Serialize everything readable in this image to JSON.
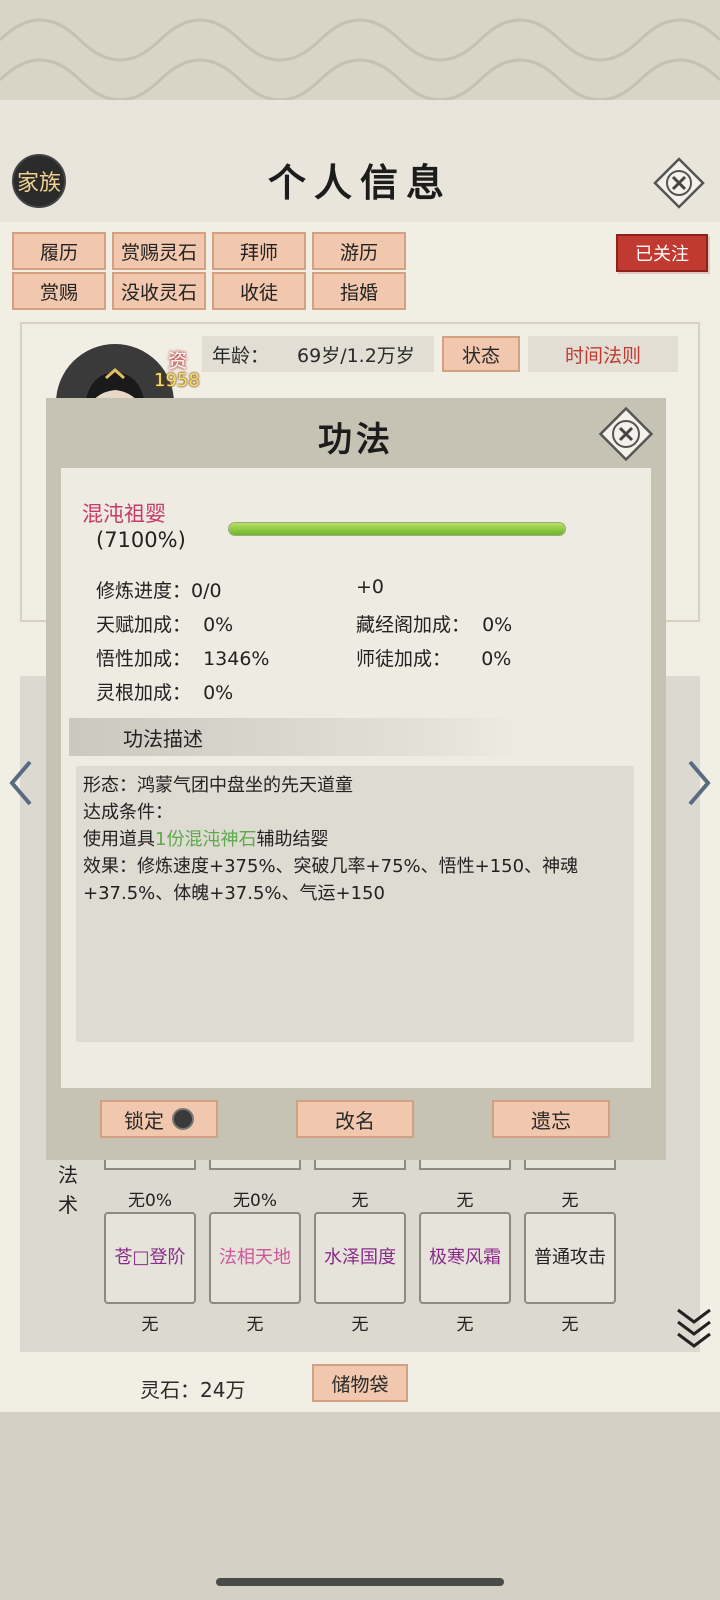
{
  "header": {
    "family_button": "家族",
    "title": "个人信息"
  },
  "tabs_row1": [
    "履历",
    "赏赐灵石",
    "拜师",
    "游历"
  ],
  "tabs_row2": [
    "赏赐",
    "没收灵石",
    "收徒",
    "指婚"
  ],
  "followed": "已关注",
  "profile": {
    "talent_label": "资",
    "talent_value": "1958",
    "age_label": "年龄：",
    "age_value": "69岁/1.2万岁",
    "state_button": "状态",
    "time_law_button": "时间法则"
  },
  "modal": {
    "title": "功法",
    "tech_name": "混沌祖婴",
    "tech_percent": "(7100%)",
    "progress_fraction": 1.0,
    "stats": {
      "cultivation_progress": "修炼进度：0/0",
      "cultivation_bonus": "+0",
      "talent_bonus": "天赋加成：  0%",
      "library_bonus": "藏经阁加成：  0%",
      "comprehension_bonus": "悟性加成：  1346%",
      "master_bonus": "师徒加成：     0%",
      "root_bonus": "灵根加成：  0%"
    },
    "desc_heading": "功法描述",
    "desc_form": "形态：鸿蒙气团中盘坐的先天道童",
    "desc_condition_label": "达成条件：",
    "desc_use_prefix": "使用道具",
    "desc_use_item": "1份混沌神石",
    "desc_use_suffix": "辅助结婴",
    "desc_effect": "效果：修炼速度+375%、突破几率+75%、悟性+150、神魂+37.5%、体魄+37.5%、气运+150",
    "btn_lock": "锁定",
    "btn_rename": "改名",
    "btn_forget": "遗忘"
  },
  "skills_section": {
    "label": "法术",
    "row0_captions": [
      "无0%",
      "无0%",
      "无",
      "无",
      "无"
    ],
    "row1": [
      {
        "name": "苍□登阶",
        "caption": "无",
        "color": "#8a2b8a"
      },
      {
        "name": "法相天地",
        "caption": "无",
        "color": "#d0559a"
      },
      {
        "name": "水泽国度",
        "caption": "无",
        "color": "#8a2b8a"
      },
      {
        "name": "极寒风霜",
        "caption": "无",
        "color": "#8a2b8a"
      },
      {
        "name": "普通攻击",
        "caption": "无",
        "color": "#222222"
      }
    ]
  },
  "footer": {
    "spirit_stones": "灵石：24万",
    "bag_button": "储物袋"
  }
}
